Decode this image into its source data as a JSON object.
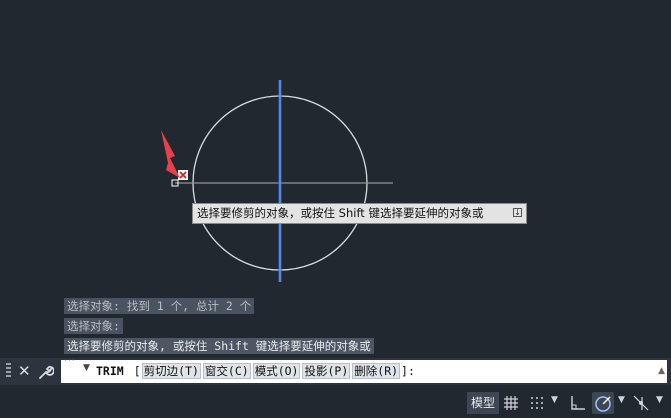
{
  "tooltip": {
    "text": "选择要修剪的对象，或按住 Shift 键选择要延伸的对象或"
  },
  "history": [
    "选择对象: 找到 1 个, 总计 2 个",
    "选择对象:",
    "选择要修剪的对象, 或按住 Shift 键选择要延伸的对象或"
  ],
  "command": {
    "name": "TRIM",
    "open_bracket": "[",
    "options": [
      "剪切边(T)",
      "窗交(C)",
      "模式(O)",
      "投影(P)",
      "删除(R)"
    ],
    "close_bracket": "]:"
  },
  "status": {
    "model_label": "模型"
  },
  "colors": {
    "background": "#212830",
    "circle": "#d9dcdf",
    "vertical_line": "#3f7df0",
    "horizontal_line": "#8e959c",
    "pointer": "#e8404a"
  },
  "icons": {
    "close": "close-icon",
    "customize": "wrench-icon",
    "grid": "grid-icon",
    "snap": "snap-dots-icon",
    "ortho": "ortho-icon",
    "polar": "polar-tracking-icon",
    "isodraft": "isodraft-icon"
  }
}
